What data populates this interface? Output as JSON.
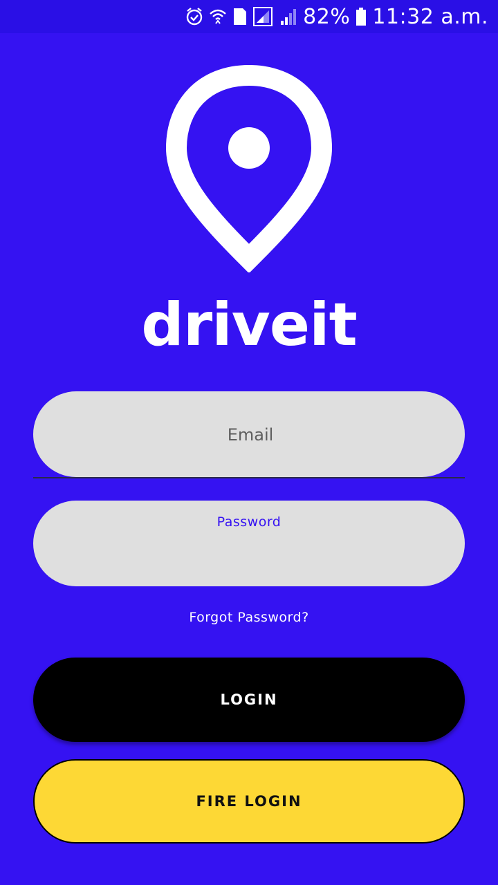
{
  "status_bar": {
    "battery_percent": "82%",
    "time": "11:32 a.m.",
    "sim_slot": "1",
    "icons": [
      "alarm-icon",
      "wifi-icon",
      "sim-icon",
      "signal-icon",
      "signal-icon",
      "battery-icon"
    ]
  },
  "app": {
    "title": "driveit"
  },
  "form": {
    "email_placeholder": "Email",
    "password_label": "Password",
    "forgot_password": "Forgot Password?",
    "login_label": "LOGIN",
    "fire_login_label": "FIRE LOGIN"
  },
  "colors": {
    "background": "#3512f2",
    "status_bar": "#2a0fe6",
    "field_background": "#dfdfdf",
    "login_button": "#000000",
    "fire_login_button": "#fdd835"
  }
}
